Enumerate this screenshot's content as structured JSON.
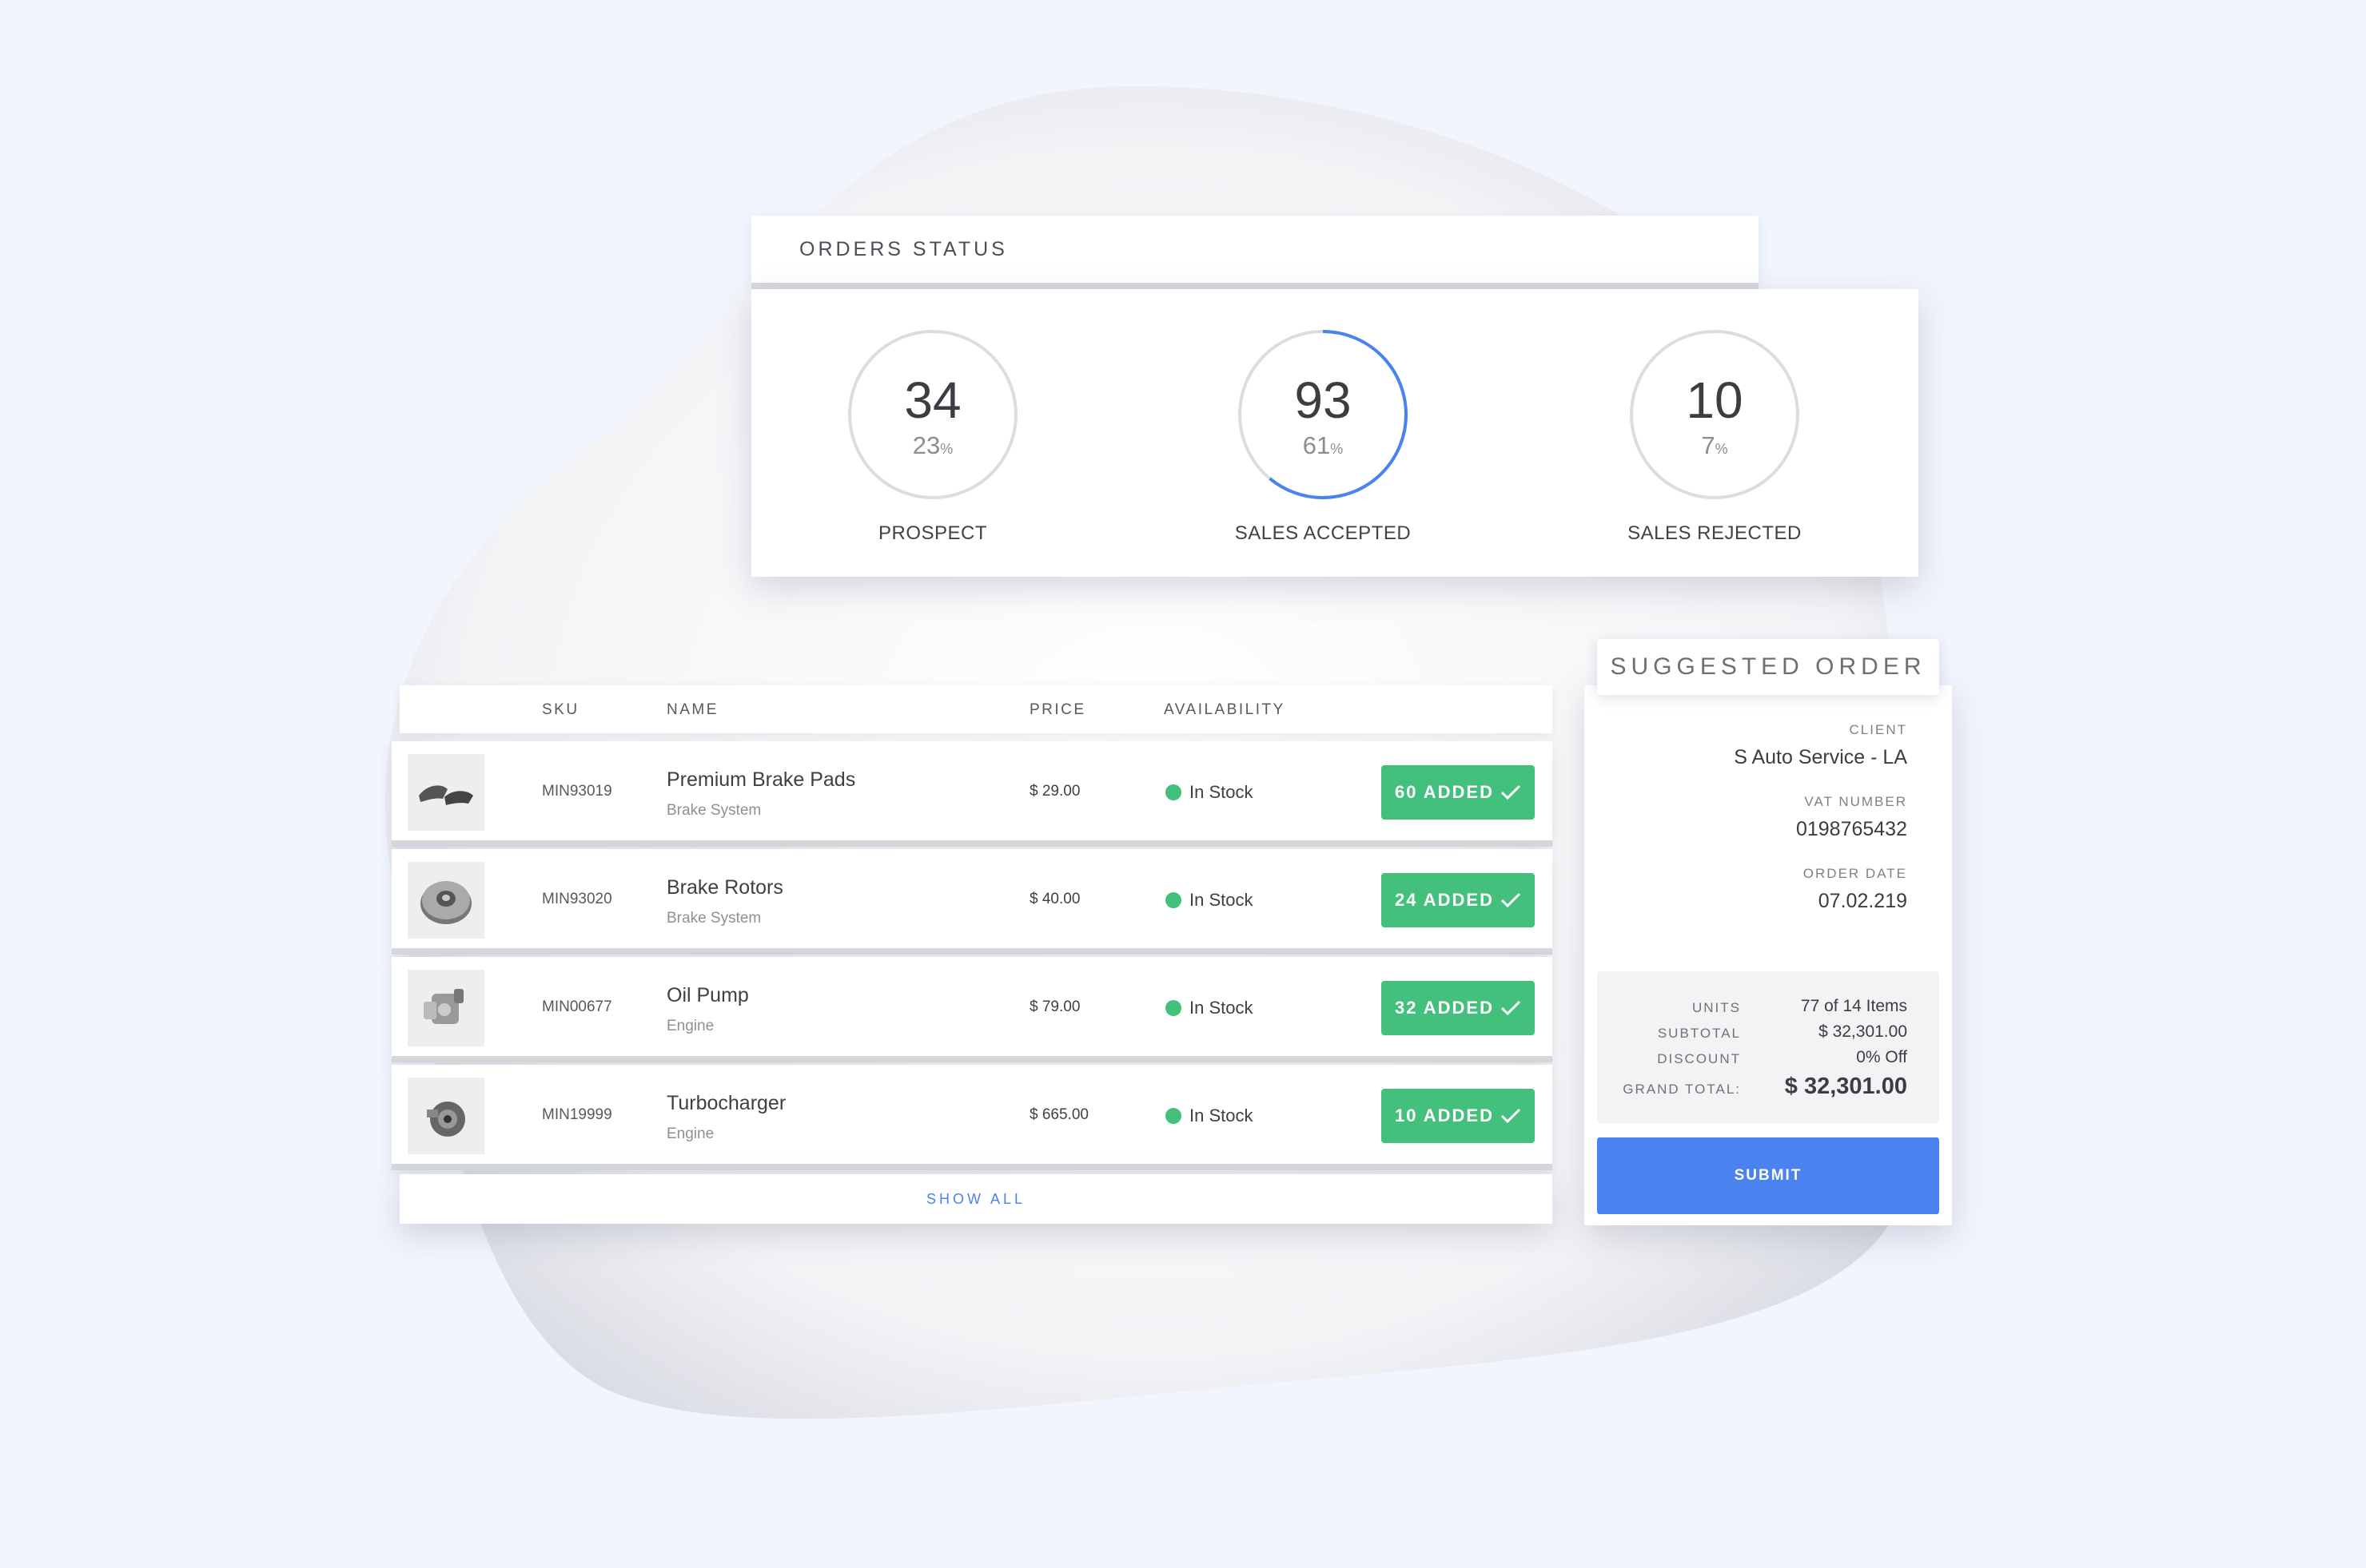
{
  "orders_status": {
    "title": "ORDERS STATUS",
    "metrics": [
      {
        "count": "34",
        "percent": "23",
        "label": "PROSPECT",
        "fraction": 0.23,
        "ring_highlighted": false
      },
      {
        "count": "93",
        "percent": "61",
        "label": "SALES ACCEPTED",
        "fraction": 0.61,
        "ring_highlighted": true
      },
      {
        "count": "10",
        "percent": "7",
        "label": "SALES REJECTED",
        "fraction": 0.07,
        "ring_highlighted": false
      }
    ],
    "percent_sign": "%"
  },
  "products": {
    "headers": {
      "sku": "SKU",
      "name": "NAME",
      "price": "PRICE",
      "availability": "AVAILABILITY"
    },
    "rows": [
      {
        "sku": "MIN93019",
        "name": "Premium Brake Pads",
        "category": "Brake System",
        "price": "$ 29.00",
        "availability": "In Stock",
        "added": "60 ADDED",
        "thumb_icon": "brake-pads-icon"
      },
      {
        "sku": "MIN93020",
        "name": "Brake Rotors",
        "category": "Brake System",
        "price": "$ 40.00",
        "availability": "In Stock",
        "added": "24 ADDED",
        "thumb_icon": "brake-rotor-icon"
      },
      {
        "sku": "MIN00677",
        "name": "Oil Pump",
        "category": "Engine",
        "price": "$ 79.00",
        "availability": "In Stock",
        "added": "32 ADDED",
        "thumb_icon": "oil-pump-icon"
      },
      {
        "sku": "MIN19999",
        "name": "Turbocharger",
        "category": "Engine",
        "price": "$ 665.00",
        "availability": "In Stock",
        "added": "10 ADDED",
        "thumb_icon": "turbocharger-icon"
      }
    ],
    "show_all": "SHOW ALL"
  },
  "suggested_order": {
    "title": "SUGGESTED ORDER",
    "client_label": "CLIENT",
    "client": "S Auto Service - LA",
    "vat_label": "VAT NUMBER",
    "vat": "0198765432",
    "date_label": "ORDER DATE",
    "date": "07.02.219",
    "units_label": "UNITS",
    "units": "77 of 14 Items",
    "subtotal_label": "SUBTOTAL",
    "subtotal": "$ 32,301.00",
    "discount_label": "DISCOUNT",
    "discount": "0% Off",
    "grand_total_label": "GRAND TOTAL:",
    "grand_total": "$ 32,301.00",
    "submit": "SUBMIT"
  },
  "colors": {
    "background": "#f1f5fd",
    "accent_blue": "#4a82f0",
    "success_green": "#44c07d",
    "ring_gray": "#dddddd"
  }
}
